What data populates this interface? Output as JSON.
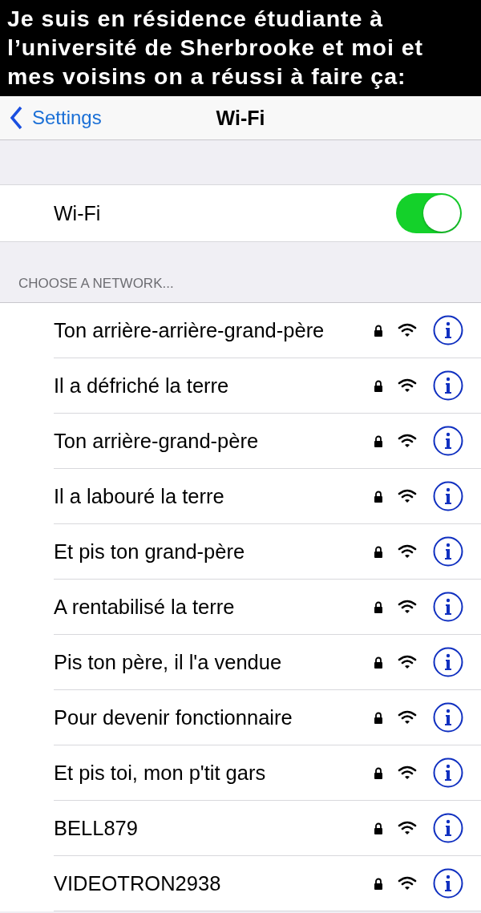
{
  "caption": "Je suis en résidence étudiante à l’université de Sherbrooke et moi et mes voisins on a réussi à faire ça:",
  "nav": {
    "back": "Settings",
    "title": "Wi-Fi"
  },
  "wifi": {
    "label": "Wi-Fi",
    "on": true
  },
  "section_header": "CHOOSE A NETWORK...",
  "networks": [
    {
      "name": "Ton arrière-arrière-grand-père",
      "locked": true
    },
    {
      "name": "Il a défriché la terre",
      "locked": true
    },
    {
      "name": "Ton arrière-grand-père",
      "locked": true
    },
    {
      "name": "Il a labouré la terre",
      "locked": true
    },
    {
      "name": "Et pis ton grand-père",
      "locked": true
    },
    {
      "name": "A rentabilisé la terre",
      "locked": true
    },
    {
      "name": "Pis ton père, il l'a vendue",
      "locked": true
    },
    {
      "name": "Pour devenir fonctionnaire",
      "locked": true
    },
    {
      "name": "Et pis toi, mon p'tit gars",
      "locked": true
    },
    {
      "name": "BELL879",
      "locked": true
    },
    {
      "name": "VIDEOTRON2938",
      "locked": true
    }
  ]
}
